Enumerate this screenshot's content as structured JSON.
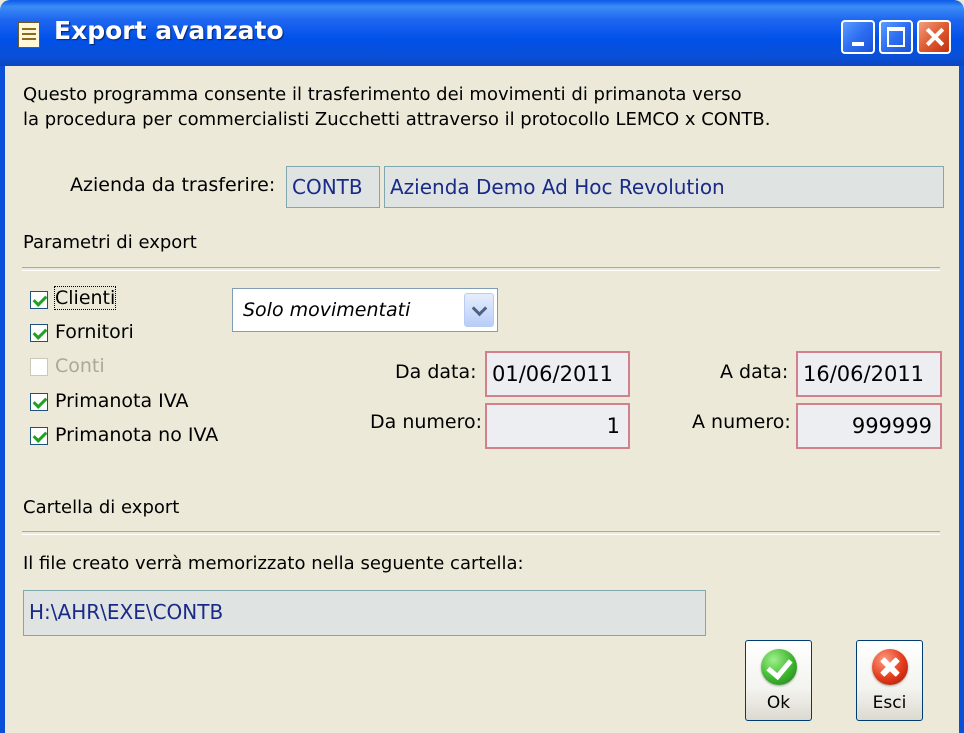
{
  "window": {
    "title": "Export avanzato",
    "icons": [
      "document-icon",
      "minimize-icon",
      "maximize-icon",
      "close-icon"
    ]
  },
  "intro": {
    "line1": "Questo programma consente il trasferimento dei movimenti di primanota verso",
    "line2": "la procedura per commercialisti Zucchetti attraverso il protocollo LEMCO x CONTB."
  },
  "company": {
    "label": "Azienda da trasferire:",
    "code": "CONTB",
    "name": "Azienda Demo Ad Hoc Revolution"
  },
  "params": {
    "header": "Parametri di export",
    "checkboxes": [
      {
        "label": "Clienti",
        "checked": true,
        "enabled": true
      },
      {
        "label": "Fornitori",
        "checked": true,
        "enabled": true
      },
      {
        "label": "Conti",
        "checked": false,
        "enabled": false
      },
      {
        "label": "Primanota IVA",
        "checked": true,
        "enabled": true
      },
      {
        "label": "Primanota no IVA",
        "checked": true,
        "enabled": true
      }
    ],
    "filter": {
      "selected": "Solo movimentati"
    },
    "date_from": {
      "label": "Da data:",
      "value": "01/06/2011"
    },
    "date_to": {
      "label": "A data:",
      "value": "16/06/2011"
    },
    "num_from": {
      "label": "Da numero:",
      "value": "1"
    },
    "num_to": {
      "label": "A numero:",
      "value": "999999"
    }
  },
  "folder": {
    "header": "Cartella di export",
    "description": "Il file creato verrà memorizzato nella seguente cartella:",
    "path": "H:\\AHR\\EXE\\CONTB"
  },
  "buttons": {
    "ok": "Ok",
    "esc": "Esci"
  },
  "colors": {
    "titlebar": "#0a4fd8",
    "dialog_bg": "#ece9d8",
    "field_text": "#1a2a88",
    "mandatory_border": "#d27f8e"
  }
}
